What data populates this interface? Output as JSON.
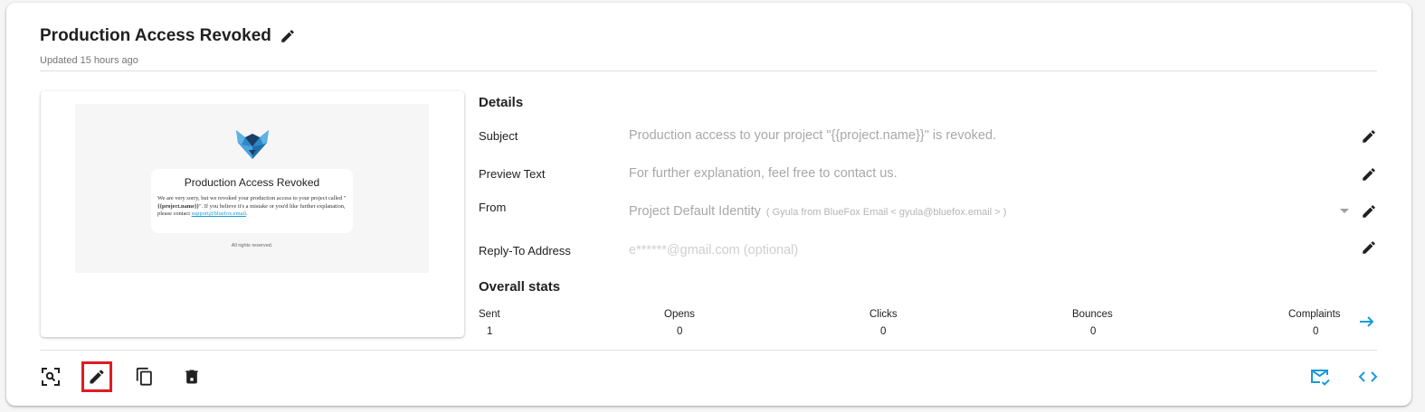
{
  "header": {
    "title": "Production Access Revoked",
    "updated": "Updated 15 hours ago"
  },
  "preview": {
    "email_title": "Production Access Revoked",
    "body_1": "We are very sorry, but we revoked your production access to your project called \"",
    "body_project": "{{project.name}}",
    "body_2": "\". If you believe it's a mistake or you'd like further explanation, please contact ",
    "body_link": "support@bluefox.email",
    "body_3": ".",
    "footer": "All rights reserved."
  },
  "details": {
    "heading": "Details",
    "subject_label": "Subject",
    "subject_value": "Production access to your project \"{{project.name}}\" is revoked.",
    "preview_label": "Preview Text",
    "preview_value": "For further explanation, feel free to contact us.",
    "from_label": "From",
    "from_value": "Project Default Identity",
    "from_sub": "( Gyula from BlueFox Email < gyula@bluefox.email > )",
    "reply_label": "Reply-To Address",
    "reply_placeholder": "e******@gmail.com (optional)"
  },
  "stats": {
    "heading": "Overall stats",
    "items": [
      {
        "label": "Sent",
        "value": "1"
      },
      {
        "label": "Opens",
        "value": "0"
      },
      {
        "label": "Clicks",
        "value": "0"
      },
      {
        "label": "Bounces",
        "value": "0"
      },
      {
        "label": "Complaints",
        "value": "0"
      }
    ]
  },
  "icons": {
    "title_edit": "pencil-icon",
    "preview_zoom": "zoom-preview-icon",
    "edit": "pencil-icon",
    "copy": "copy-icon",
    "delete": "delete-icon",
    "send_test": "mark-email-read-icon",
    "code": "code-icon",
    "stats_arrow": "arrow-right-icon"
  },
  "colors": {
    "accent": "#1a9bd7",
    "highlight": "#e01b24",
    "logo_blue": "#2f86c9",
    "logo_dark": "#1b3f66"
  }
}
